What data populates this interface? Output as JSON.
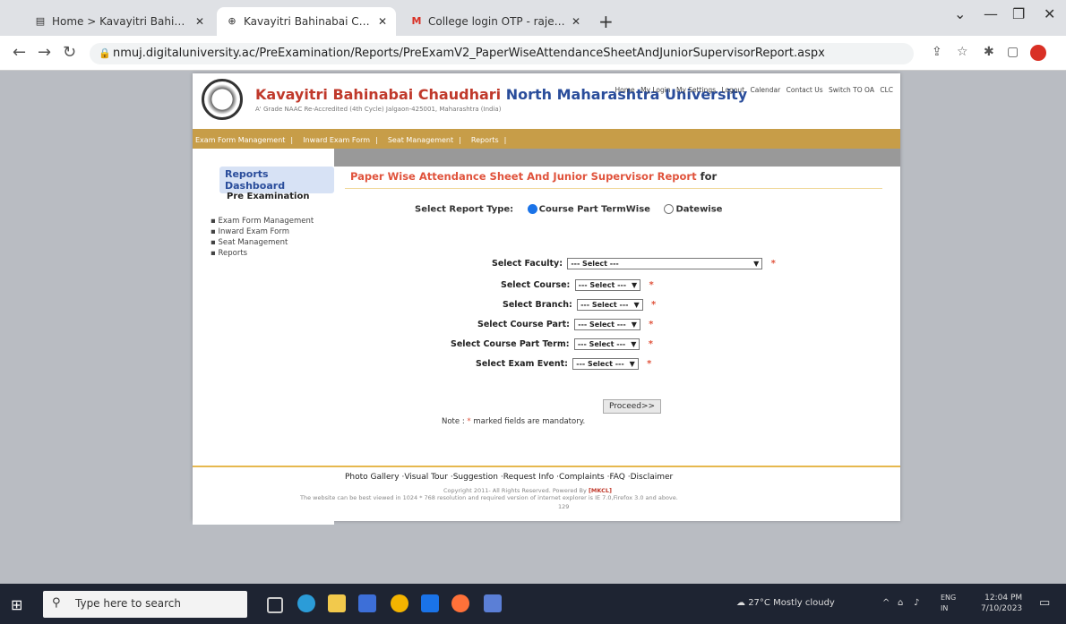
{
  "browser": {
    "tabs": [
      {
        "label": "Home > Kavayitri Bahinabai Cha"
      },
      {
        "label": "Kavayitri Bahinabai Chaudhari N"
      },
      {
        "label": "College login OTP - rajeshjadha"
      }
    ],
    "url": "nmuj.digitaluniversity.ac/PreExamination/Reports/PreExamV2_PaperWiseAttendanceSheetAndJuniorSupervisorReport.aspx"
  },
  "site": {
    "univ_name_part1": "Kavayitri Bahinabai Chaudhari",
    "univ_name_part2": "North Maharashtra University",
    "subline": "A' Grade NAAC Re-Accredited (4th Cycle) Jalgaon-425001, Maharashtra (India)",
    "toplinks": [
      "Home",
      "My Login",
      "My Settings",
      "Logout",
      "Calendar",
      "Contact Us",
      "Switch TO OA",
      "CLC"
    ],
    "menu": [
      "Exam Form Management",
      "Inward Exam Form",
      "Seat Management",
      "Reports"
    ]
  },
  "sidebar": {
    "title": "Reports Dashboard",
    "subtitle": "Pre Examination",
    "items": [
      "Exam Form Management",
      "Inward Exam Form",
      "Seat Management",
      "Reports"
    ]
  },
  "content": {
    "title": "Paper Wise Attendance Sheet And Junior Supervisor Report",
    "title_for": "for",
    "report_type_label": "Select Report Type:",
    "report_type_options": [
      "Course Part TermWise",
      "Datewise"
    ],
    "fields": [
      {
        "label": "Select Faculty:",
        "value": "--- Select ---"
      },
      {
        "label": "Select Course:",
        "value": "--- Select ---"
      },
      {
        "label": "Select Branch:",
        "value": "--- Select ---"
      },
      {
        "label": "Select Course Part:",
        "value": "--- Select ---"
      },
      {
        "label": "Select Course Part Term:",
        "value": "--- Select ---"
      },
      {
        "label": "Select Exam Event:",
        "value": "--- Select ---"
      }
    ],
    "proceed_label": "Proceed>>",
    "note_prefix": "Note :",
    "note_star": "*",
    "note_text": "marked fields are mandatory."
  },
  "footer": {
    "links": [
      "Photo Gallery",
      "Visual Tour",
      "Suggestion",
      "Request Info",
      "Complaints",
      "FAQ",
      "Disclaimer"
    ],
    "copyright": "Copyright 2011- All Rights Reserved. Powered By",
    "powered": "[MKCL]",
    "best_view": "The website can be best viewed in 1024 * 768 resolution and required version of internet explorer is IE 7.0,Firefox 3.0 and above.",
    "number": "129"
  },
  "taskbar": {
    "search_placeholder": "Type here to search",
    "weather_temp": "27°C",
    "weather_text": "Mostly cloudy",
    "lang1": "ENG",
    "lang2": "IN",
    "time": "12:04 PM",
    "date": "7/10/2023"
  }
}
